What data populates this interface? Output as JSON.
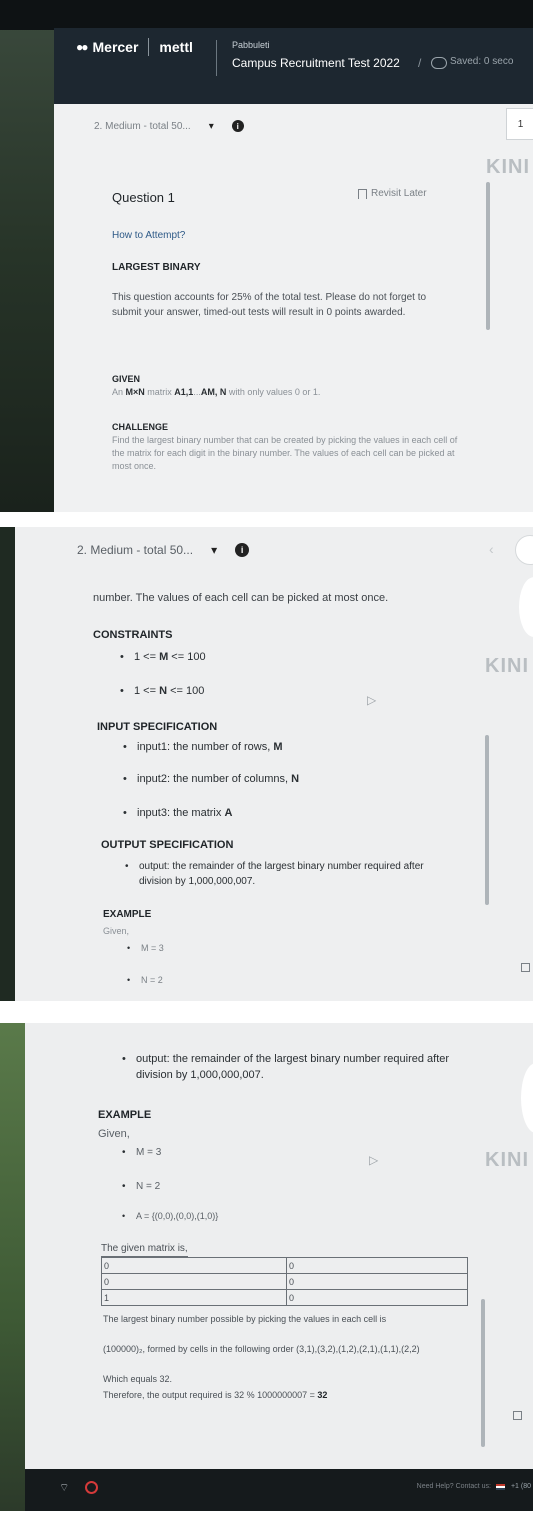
{
  "header": {
    "logo_left": "Mercer",
    "logo_right": "mettl",
    "company": "Pabbuleti",
    "test_title": "Campus Recruitment Test 2022",
    "slash": "/",
    "saved": "Saved: 0 seco"
  },
  "section": {
    "dropdown_label": "2. Medium - total 50...",
    "dropdown_caret": "▾",
    "info_glyph": "i",
    "page_number": "1",
    "right_cut_text": "KINI"
  },
  "question": {
    "title": "Question 1",
    "revisit": "Revisit Later",
    "how_to": "How to Attempt?",
    "name": "LARGEST BINARY",
    "intro": "This question accounts for 25% of the total test. Please do not forget to submit your answer, timed-out tests will result in 0 points awarded.",
    "given_heading": "GIVEN",
    "given_prefix": "An ",
    "given_mn": "M×N",
    "given_mid": " matrix ",
    "given_a11": "A1,1",
    "given_dots": "...",
    "given_amn": "AM, N",
    "given_suffix": " with only values 0 or 1.",
    "challenge_heading": "CHALLENGE",
    "challenge_text": "Find the largest binary number that can be created by picking the values in each cell of the matrix for each digit in the binary number. The values of each cell can be picked at most once.",
    "challenge_tail": "number. The values of each cell can be picked at most once.",
    "constraints_heading": "CONSTRAINTS",
    "constraints": [
      {
        "pre": "1 <= ",
        "var": "M",
        "post": " <= 100"
      },
      {
        "pre": "1 <= ",
        "var": "N",
        "post": " <= 100"
      }
    ],
    "input_heading": "INPUT SPECIFICATION",
    "inputs": [
      {
        "pre": "input1: the number of rows, ",
        "var": "M"
      },
      {
        "pre": "input2: the number of columns, ",
        "var": "N"
      },
      {
        "pre": "input3: the matrix ",
        "var": "A"
      }
    ],
    "output_heading": "OUTPUT SPECIFICATION",
    "output_text": "output: the remainder of the largest binary number required after division by 1,000,000,007.",
    "example_heading": "EXAMPLE",
    "example_given": "Given,",
    "example_m": "M = 3",
    "example_n": "N = 2",
    "example_a": "A = {(0,0),(0,0),(1,0)}",
    "matrix_caption": "The given matrix is,",
    "matrix": [
      [
        "0",
        "0"
      ],
      [
        "0",
        "0"
      ],
      [
        "1",
        "0"
      ]
    ],
    "explain_1": "The largest binary number possible by picking the values in each cell is",
    "explain_2": "(100000)₂, formed by cells in the following order (3,1),(3,2),(1,2),(2,1),(1,1),(2,2)",
    "explain_3": "Which equals 32.",
    "explain_4_pre": "Therefore, the output required is 32 % 1000000007 = ",
    "explain_4_val": "32"
  },
  "footer": {
    "help": "Need Help? Contact us:",
    "phone": "+1 (80"
  }
}
